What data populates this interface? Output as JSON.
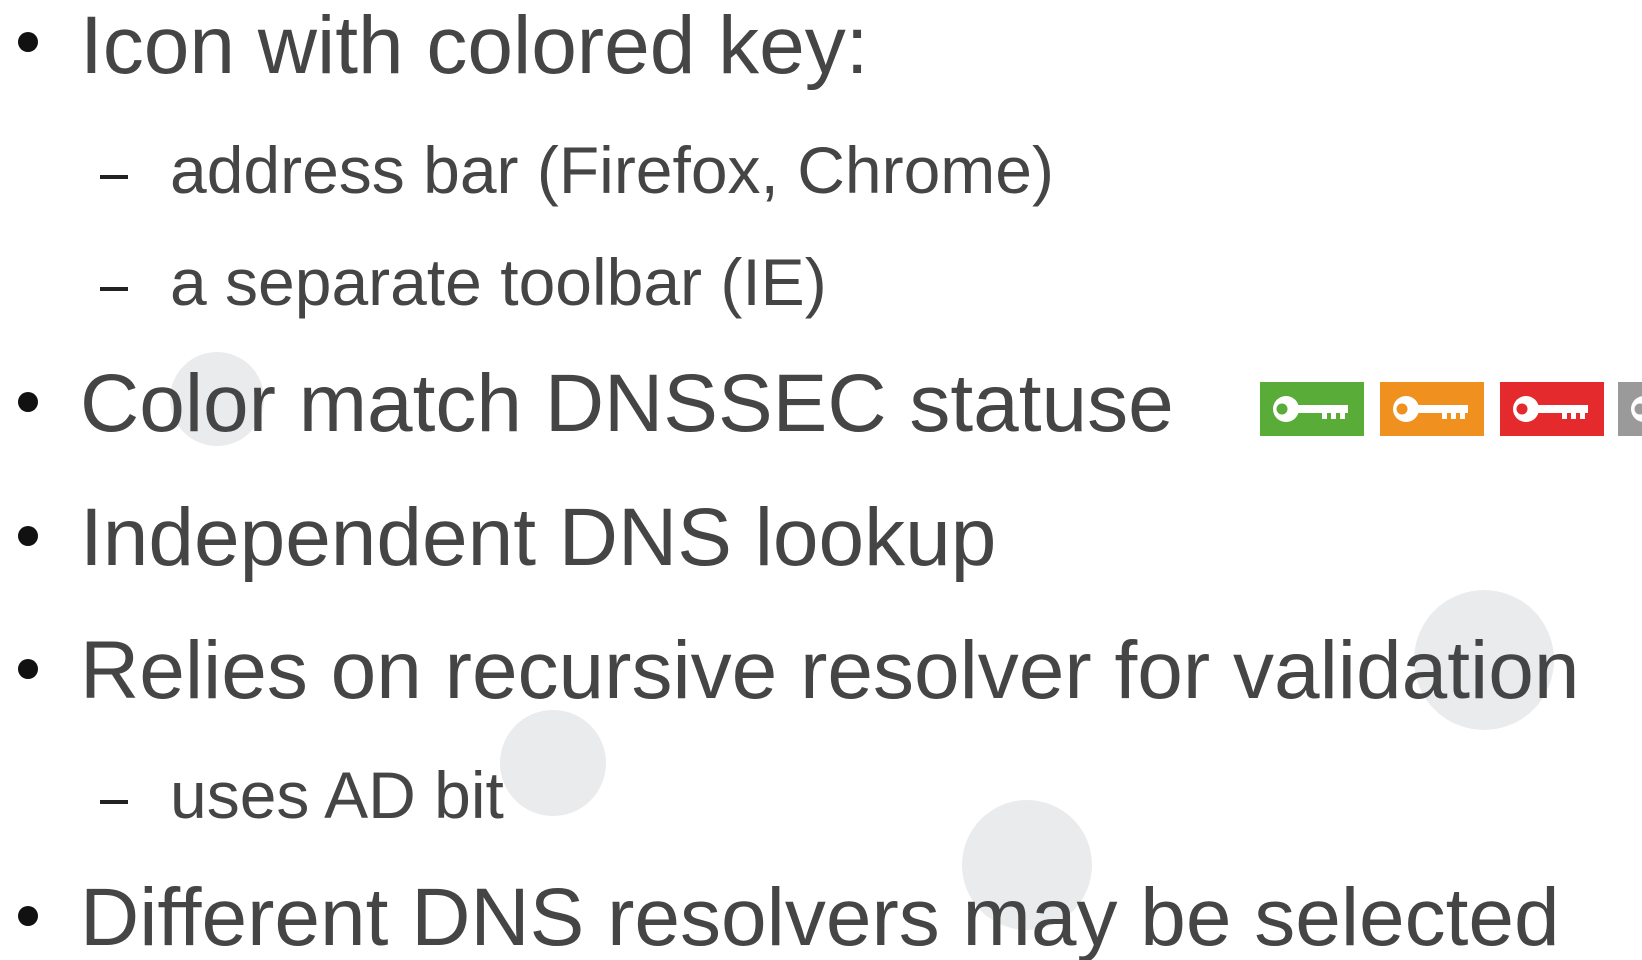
{
  "bullets": [
    {
      "text": "Icon with colored key:"
    },
    {
      "text": "address bar (Firefox, Chrome)"
    },
    {
      "text": "a separate toolbar (IE)"
    },
    {
      "text": "Color match DNSSEC statuse"
    },
    {
      "text": "Independent DNS lookup"
    },
    {
      "text": "Relies on recursive resolver for validation"
    },
    {
      "text": "uses AD bit"
    },
    {
      "text": "Different DNS resolvers may be selected"
    }
  ],
  "status_keys": [
    {
      "icon": "key-icon",
      "color": "#5aac38"
    },
    {
      "icon": "key-icon",
      "color": "#f0901e"
    },
    {
      "icon": "key-icon",
      "color": "#e42a2c"
    },
    {
      "icon": "key-icon",
      "color": "#9a9a9a"
    }
  ]
}
